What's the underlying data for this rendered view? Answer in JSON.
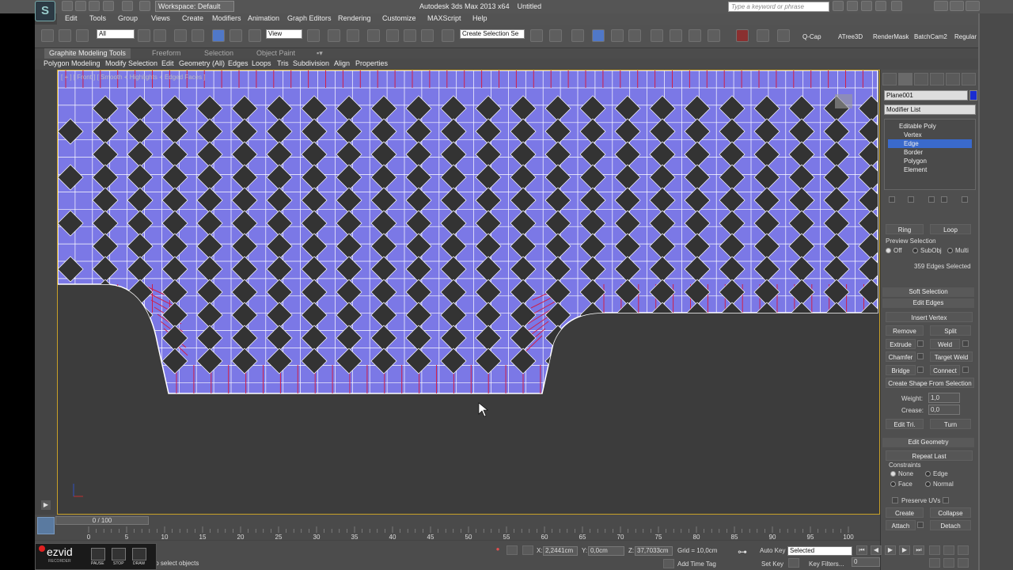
{
  "window": {
    "title": "Autodesk 3ds Max 2013 x64",
    "document": "Untitled",
    "workspace": "Workspace: Default",
    "search_placeholder": "Type a keyword or phrase",
    "app_logo": "S"
  },
  "menubar": [
    "Edit",
    "Tools",
    "Group",
    "Views",
    "Create",
    "Modifiers",
    "Animation",
    "Graph Editors",
    "Rendering",
    "Customize",
    "MAXScript",
    "Help"
  ],
  "toolbar": {
    "selection_filter": "All",
    "ref_coord": "View",
    "named_selection": "Create Selection Se",
    "plugins": [
      "Q-Cap",
      "ATree3D",
      "RenderMask",
      "BatchCam2",
      "Regular"
    ]
  },
  "ribbon": {
    "tabs": [
      "Graphite Modeling Tools",
      "Freeform",
      "Selection",
      "Object Paint"
    ],
    "active_tab": "Graphite Modeling Tools",
    "menu": [
      "Polygon Modeling",
      "Modify Selection",
      "Edit",
      "Geometry (All)",
      "Edges",
      "Loops",
      "Tris",
      "Subdivision",
      "Align",
      "Properties"
    ]
  },
  "viewport": {
    "label": "[ + ] [ Front ] [ Smooth + Highlights + Edged Faces ]",
    "mesh_color": "#7b78e6",
    "edge_color": "#ffffff",
    "selected_edge_color": "#d0204a",
    "tile_color": "#333333",
    "background": "#3c3c3c"
  },
  "command_panel": {
    "object_name": "Plane001",
    "object_color": "#1a2cd0",
    "modifier_list": "Modifier List",
    "stack": [
      "Editable Poly",
      "Vertex",
      "Edge",
      "Border",
      "Polygon",
      "Element"
    ],
    "stack_selected": "Edge",
    "selection": {
      "ring": "Ring",
      "loop": "Loop",
      "preview_label": "Preview Selection",
      "preview_options": [
        "Off",
        "SubObj",
        "Multi"
      ],
      "preview_selected": "Off",
      "status": "359 Edges Selected"
    },
    "soft_selection": "Soft Selection",
    "edit_edges": {
      "title": "Edit Edges",
      "insert_vertex": "Insert Vertex",
      "remove": "Remove",
      "split": "Split",
      "extrude": "Extrude",
      "weld": "Weld",
      "chamfer": "Chamfer",
      "target_weld": "Target Weld",
      "bridge": "Bridge",
      "connect": "Connect",
      "create_shape": "Create Shape From Selection",
      "weight_label": "Weight:",
      "weight_value": "1,0",
      "crease_label": "Crease:",
      "crease_value": "0,0",
      "edit_tri": "Edit Tri.",
      "turn": "Turn"
    },
    "edit_geometry": {
      "title": "Edit Geometry",
      "repeat_last": "Repeat Last",
      "constraints_label": "Constraints",
      "constraints": [
        "None",
        "Edge",
        "Face",
        "Normal"
      ],
      "constraint_selected": "None",
      "preserve_uvs": "Preserve UVs",
      "create": "Create",
      "collapse": "Collapse",
      "attach": "Attach",
      "detach": "Detach"
    }
  },
  "timeline": {
    "slider": "0 / 100",
    "ticks": [
      "0",
      "5",
      "10",
      "15",
      "20",
      "25",
      "30",
      "35",
      "40",
      "45",
      "50",
      "55",
      "60",
      "65",
      "70",
      "75",
      "80",
      "85",
      "90",
      "95",
      "100"
    ]
  },
  "status": {
    "recorder_brand": "ezvid",
    "recorder_sub": "RECORDER",
    "recorder_buttons": [
      "PAUSE",
      "STOP",
      "DRAW"
    ],
    "prompt": "to select objects",
    "x_label": "X:",
    "x_value": "2,2441cm",
    "y_label": "Y:",
    "y_value": "0,0cm",
    "z_label": "Z:",
    "z_value": "37,7033cm",
    "grid": "Grid = 10,0cm",
    "add_time_tag": "Add Time Tag",
    "auto_key": "Auto Key",
    "auto_key_value": "Selected",
    "set_key": "Set Key",
    "key_filters": "Key Filters...",
    "frame": "0"
  }
}
